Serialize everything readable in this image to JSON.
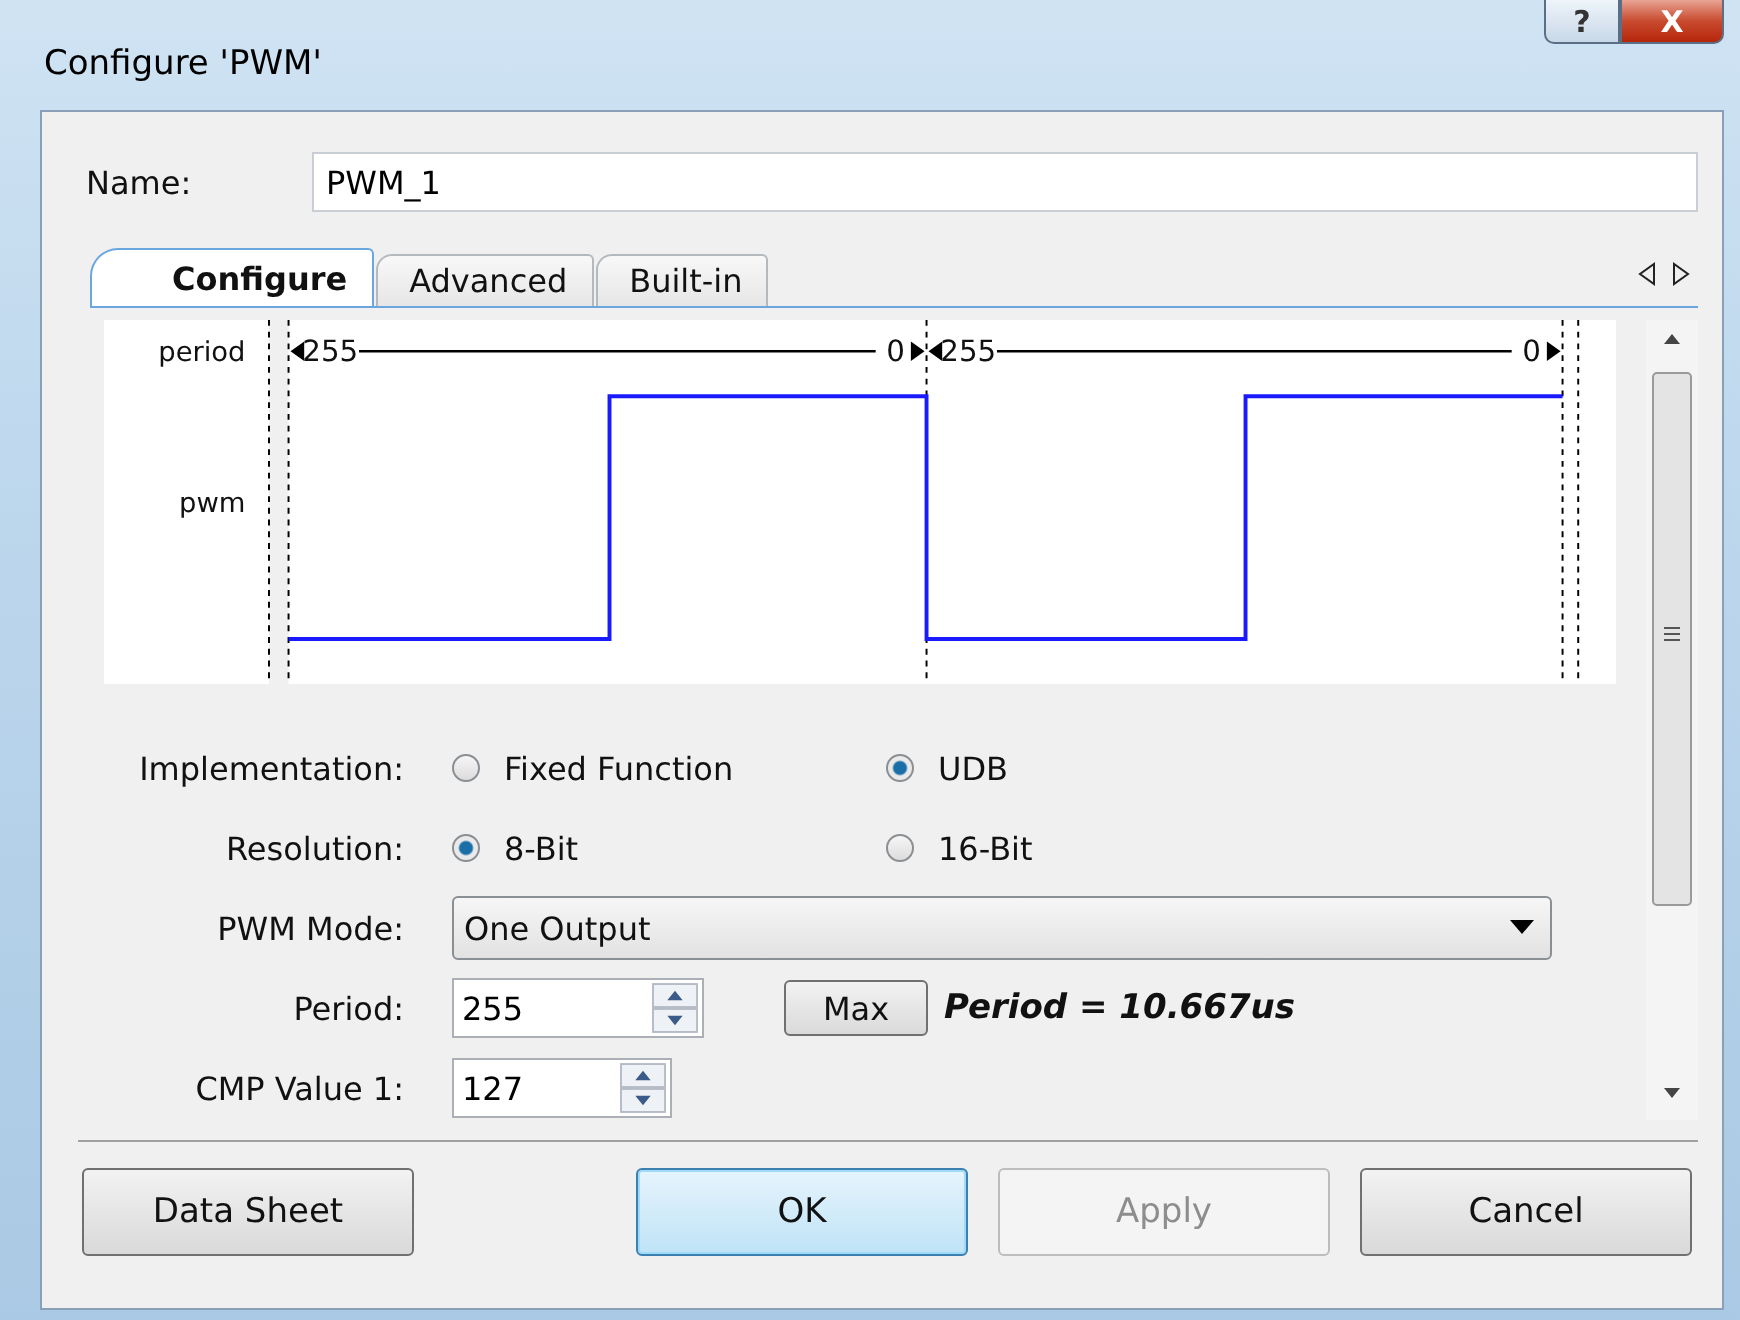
{
  "window": {
    "title": "Configure 'PWM'",
    "help": "?",
    "close": "X"
  },
  "name": {
    "label": "Name:",
    "value": "PWM_1"
  },
  "tabs": [
    {
      "label": "Configure",
      "selected": true
    },
    {
      "label": "Advanced",
      "selected": false
    },
    {
      "label": "Built-in",
      "selected": false
    }
  ],
  "diagram": {
    "row_labels": [
      "period",
      "pwm"
    ],
    "periods": [
      {
        "start": "255",
        "end": "0"
      },
      {
        "start": "255",
        "end": "0"
      }
    ]
  },
  "fields": [
    {
      "kind": "radio",
      "label": "Implementation:",
      "options": [
        {
          "label": "Fixed Function",
          "selected": false
        },
        {
          "label": "UDB",
          "selected": true
        }
      ]
    },
    {
      "kind": "radio",
      "label": "Resolution:",
      "options": [
        {
          "label": "8-Bit",
          "selected": true
        },
        {
          "label": "16-Bit",
          "selected": false
        }
      ]
    },
    {
      "kind": "select",
      "label": "PWM Mode:",
      "value": "One Output"
    },
    {
      "kind": "spinner",
      "label": "Period:",
      "value": "255",
      "button": "Max",
      "note": "Period = 10.667us"
    },
    {
      "kind": "spinner",
      "label": "CMP Value 1:",
      "value": "127"
    }
  ],
  "buttons": [
    {
      "label": "Data Sheet",
      "focused": false,
      "disabled": false
    },
    {
      "label": "OK",
      "focused": true,
      "disabled": false
    },
    {
      "label": "Apply",
      "focused": false,
      "disabled": true
    },
    {
      "label": "Cancel",
      "focused": false,
      "disabled": false
    }
  ]
}
